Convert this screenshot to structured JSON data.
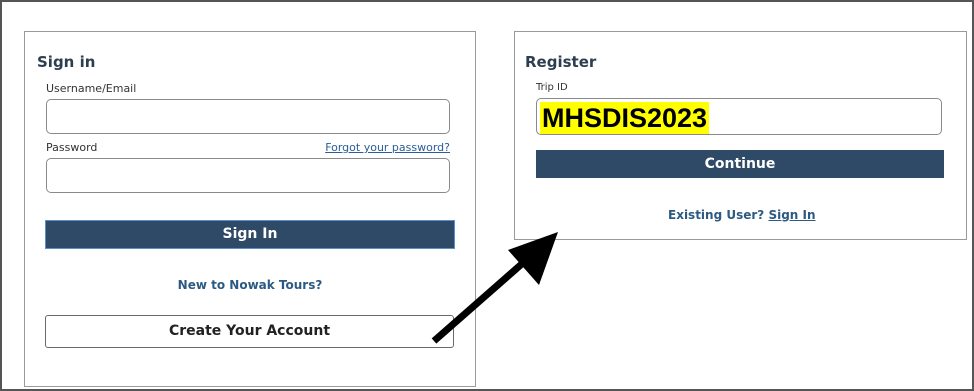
{
  "signin": {
    "title": "Sign in",
    "username_label": "Username/Email",
    "username_value": "",
    "password_label": "Password",
    "password_value": "",
    "forgot_link": "Forgot your password?",
    "signin_button": "Sign In",
    "new_to_text": "New to Nowak Tours?",
    "create_account_button": "Create Your Account"
  },
  "register": {
    "title": "Register",
    "trip_id_label": "Trip ID",
    "trip_id_value": "MHSDIS2023",
    "continue_button": "Continue",
    "existing_user_text": "Existing User?",
    "existing_signin_link": "Sign In"
  },
  "colors": {
    "button_primary": "#2e4a66",
    "link": "#2a5d9a",
    "highlight": "#ffff00",
    "arrow": "#000000"
  },
  "icons": {
    "annotation": "arrow-icon"
  }
}
